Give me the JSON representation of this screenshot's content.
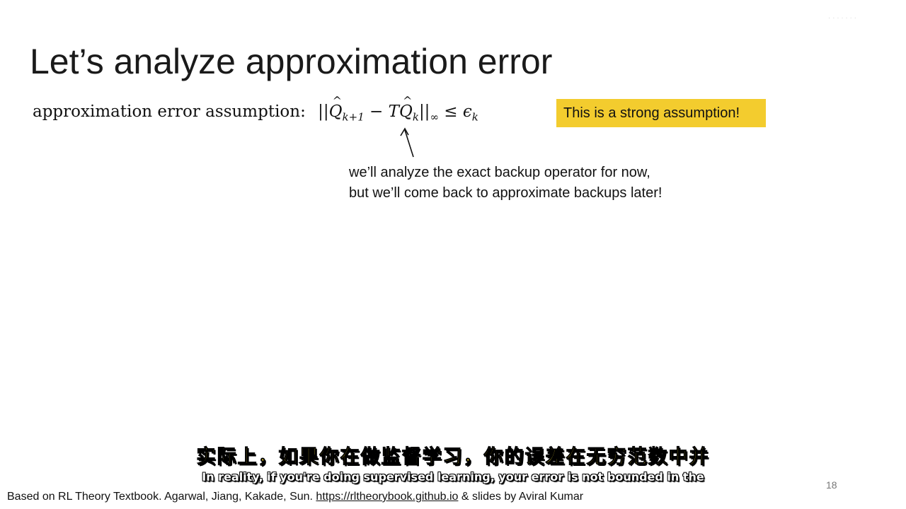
{
  "slide": {
    "title": "Let’s analyze approximation error",
    "assumption_label": "approximation error assumption:",
    "formula": {
      "open": "||",
      "q1": "Q",
      "q1_sub": "k+1",
      "minus": " − ",
      "t": "T",
      "q2": "Q",
      "q2_sub": "k",
      "close": "||",
      "norm_sub": "∞",
      "leq": " ≤ ",
      "eps": "ϵ",
      "eps_sub": "k"
    },
    "callout": "This is a strong assumption!",
    "note_lines": [
      "we’ll analyze the exact backup operator for now,",
      "but we’ll come back to approximate backups later!"
    ],
    "page_number": "18"
  },
  "subtitles": {
    "chinese": "实际上，如果你在做监督学习，你的误差在无穷范数中并",
    "english": "In reality, if you're doing supervised learning, your error is not bounded in the"
  },
  "footer": {
    "prefix": "Based on RL Theory Textbook. Agarwal, Jiang, Kakade, Sun. ",
    "link": "https://rltheorybook.github.io",
    "suffix": " & slides by Aviral Kumar"
  },
  "colors": {
    "callout_bg": "#f3cc2e",
    "subtitle_cn": "#ffe53b"
  }
}
